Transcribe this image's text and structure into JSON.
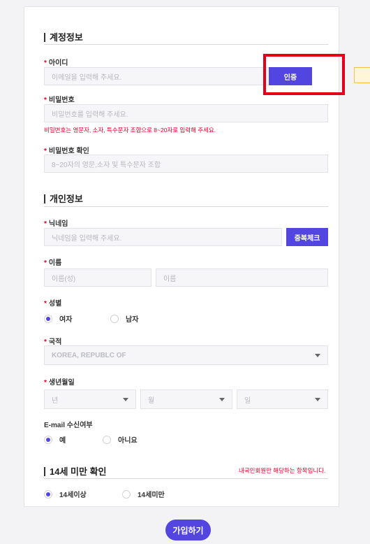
{
  "account": {
    "title": "계정정보",
    "id_label": "아이디",
    "id_placeholder": "이메일을 입력해 주세요.",
    "verify_button": "인증",
    "password_label": "비밀번호",
    "password_placeholder": "비밀번호를 입력해 주세요.",
    "password_hint": "비밀번호는 영문자, 소자, 특수문자 조합으로 8~20자로 입력해 주세요.",
    "password_confirm_label": "비밀번호 확인",
    "password_confirm_placeholder": "8~20자의 영문,소자 및 특수문자 조합"
  },
  "personal": {
    "title": "개인정보",
    "nickname_label": "닉네임",
    "nickname_placeholder": "닉네임을 입력해 주세요.",
    "duplicate_button": "중복체크",
    "name_label": "이름",
    "last_name_placeholder": "이름(성)",
    "first_name_placeholder": "이름",
    "gender_label": "성별",
    "gender_options": [
      "여자",
      "남자"
    ],
    "gender_selected": "여자",
    "nationality_label": "국적",
    "nationality_value": "KOREA, REPUBLC OF",
    "birth_label": "생년월일",
    "birth_year": "년",
    "birth_month": "월",
    "birth_day": "일",
    "email_consent_label": "E-mail 수신여부",
    "email_consent_options": [
      "예",
      "아니요"
    ],
    "email_consent_selected": "예"
  },
  "age_check": {
    "title": "14세 미만 확인",
    "note": "내국인회원만 해당하는 항목입니다.",
    "options": [
      "14세이상",
      "14세미만"
    ],
    "selected": "14세이상"
  },
  "required_mark": "*",
  "submit_button": "가입하기",
  "colors": {
    "accent": "#5346e0",
    "required": "#e0002a",
    "highlight_box": "#e4001a"
  }
}
